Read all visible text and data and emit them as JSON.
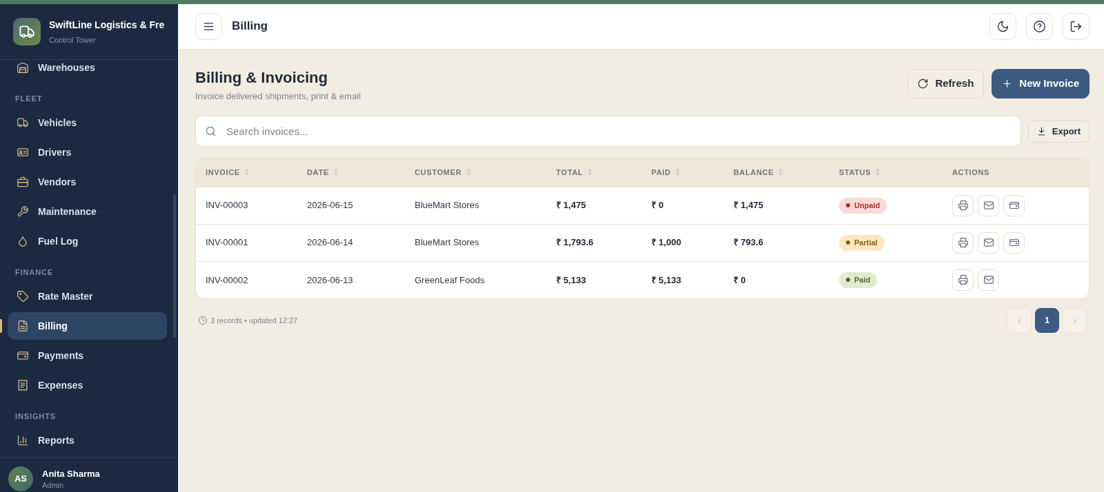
{
  "brand": {
    "name": "SwiftLine Logistics & Fre",
    "subtitle": "Control Tower"
  },
  "sidebar": {
    "sections": [
      {
        "items": [
          {
            "label": "Warehouses",
            "selected": false
          }
        ]
      },
      {
        "title": "FLEET",
        "items": [
          {
            "label": "Vehicles",
            "selected": false
          },
          {
            "label": "Drivers",
            "selected": false
          },
          {
            "label": "Vendors",
            "selected": false
          },
          {
            "label": "Maintenance",
            "selected": false
          },
          {
            "label": "Fuel Log",
            "selected": false
          }
        ]
      },
      {
        "title": "FINANCE",
        "items": [
          {
            "label": "Rate Master",
            "selected": false
          },
          {
            "label": "Billing",
            "selected": true
          },
          {
            "label": "Payments",
            "selected": false
          },
          {
            "label": "Expenses",
            "selected": false
          }
        ]
      },
      {
        "title": "INSIGHTS",
        "items": [
          {
            "label": "Reports",
            "selected": false
          }
        ]
      }
    ]
  },
  "user": {
    "initials": "AS",
    "name": "Anita Sharma",
    "role": "Admin"
  },
  "topbar": {
    "title": "Billing"
  },
  "page": {
    "title": "Billing & Invoicing",
    "subtitle": "Invoice delivered shipments, print & email"
  },
  "header_buttons": [
    {
      "kind": "secondary",
      "label": "Refresh"
    },
    {
      "kind": "primary",
      "label": "New Invoice"
    }
  ],
  "search": {
    "placeholder": "Search invoices..."
  },
  "export": {
    "label": "Export"
  },
  "table": {
    "columns": [
      {
        "label": "INVOICE",
        "sortable": true
      },
      {
        "label": "DATE",
        "sortable": true
      },
      {
        "label": "CUSTOMER",
        "sortable": true
      },
      {
        "label": "TOTAL",
        "sortable": true
      },
      {
        "label": "PAID",
        "sortable": true
      },
      {
        "label": "BALANCE",
        "sortable": true
      },
      {
        "label": "STATUS",
        "sortable": true
      },
      {
        "label": "ACTIONS",
        "sortable": false
      }
    ],
    "rows": [
      {
        "invoice": "INV-00003",
        "date": "2026-06-15",
        "customer": "BlueMart Stores",
        "total": "₹ 1,475",
        "paid": "₹ 0",
        "balance": "₹ 1,475",
        "status": {
          "label": "Unpaid",
          "kind": "unpaid",
          "color": "#a3312b"
        },
        "payable": true
      },
      {
        "invoice": "INV-00001",
        "date": "2026-06-14",
        "customer": "BlueMart Stores",
        "total": "₹ 1,793.6",
        "paid": "₹ 1,000",
        "balance": "₹ 793.6",
        "status": {
          "label": "Partial",
          "kind": "partial",
          "color": "#8b5a14"
        },
        "payable": true
      },
      {
        "invoice": "INV-00002",
        "date": "2026-06-13",
        "customer": "GreenLeaf Foods",
        "total": "₹ 5,133",
        "paid": "₹ 5,133",
        "balance": "₹ 0",
        "status": {
          "label": "Paid",
          "kind": "paid",
          "color": "#4d6620"
        },
        "payable": false
      }
    ]
  },
  "footer": {
    "summary": "3 records • updated 12:27"
  },
  "pagination": {
    "prev": {
      "label": "‹",
      "disabled": true
    },
    "pages": [
      {
        "label": "1",
        "selected": true
      }
    ],
    "next": {
      "label": "›",
      "disabled": true
    }
  }
}
